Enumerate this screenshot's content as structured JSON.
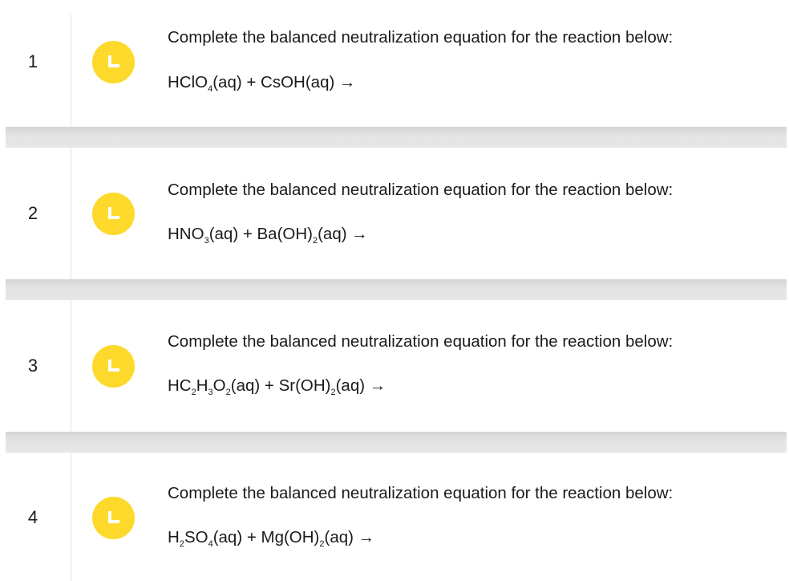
{
  "questions": [
    {
      "number": "1",
      "status_icon": "clock-icon",
      "prompt": "Complete the balanced neutralization equation for the reaction below:",
      "equation": [
        {
          "t": "HClO"
        },
        {
          "s": "4"
        },
        {
          "t": "(aq) + CsOH(aq) →"
        }
      ]
    },
    {
      "number": "2",
      "status_icon": "clock-icon",
      "prompt": "Complete the balanced neutralization equation for the reaction below:",
      "equation": [
        {
          "t": "HNO"
        },
        {
          "s": "3"
        },
        {
          "t": "(aq) + Ba(OH)"
        },
        {
          "s": "2"
        },
        {
          "t": "(aq) →"
        }
      ]
    },
    {
      "number": "3",
      "status_icon": "clock-icon",
      "prompt": "Complete the balanced neutralization equation for the reaction below:",
      "equation": [
        {
          "t": "HC"
        },
        {
          "s": "2"
        },
        {
          "t": "H"
        },
        {
          "s": "3"
        },
        {
          "t": "O"
        },
        {
          "s": "2"
        },
        {
          "t": "(aq) + Sr(OH)"
        },
        {
          "s": "2"
        },
        {
          "t": "(aq) →"
        }
      ]
    },
    {
      "number": "4",
      "status_icon": "clock-icon",
      "prompt": "Complete the balanced neutralization equation for the reaction below:",
      "equation": [
        {
          "t": "H"
        },
        {
          "s": "2"
        },
        {
          "t": "SO"
        },
        {
          "s": "4"
        },
        {
          "t": "(aq) + Mg(OH)"
        },
        {
          "s": "2"
        },
        {
          "t": "(aq) →"
        }
      ]
    }
  ],
  "colors": {
    "status_badge": "#fdd92c",
    "separator": "#e4e4e4",
    "divider": "#e2e2e2"
  }
}
